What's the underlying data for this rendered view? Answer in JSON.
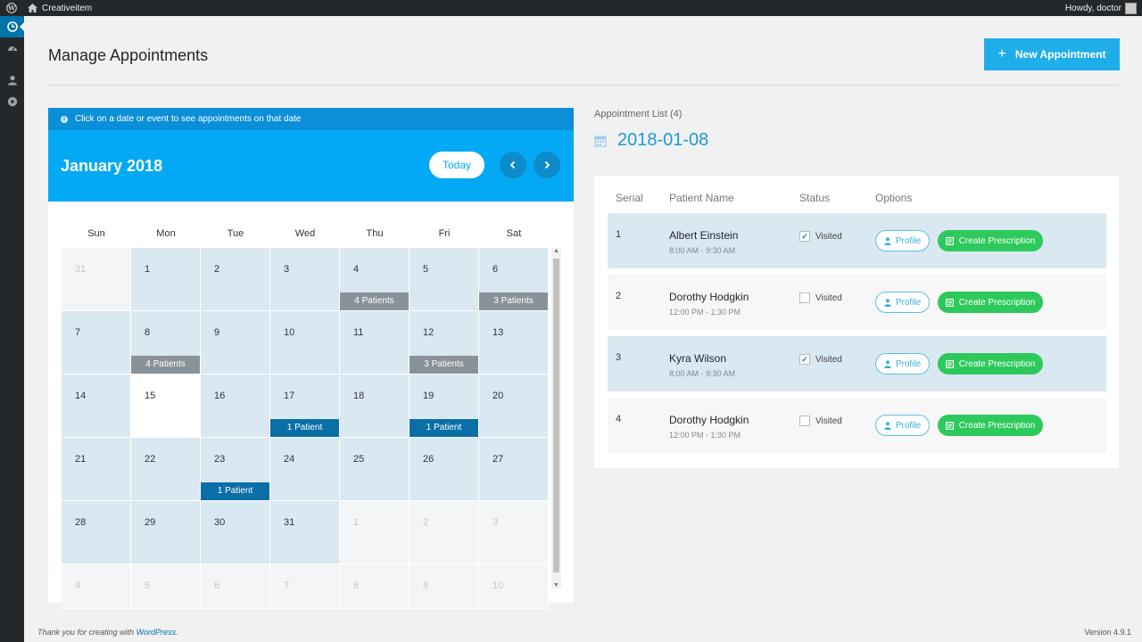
{
  "adminbar": {
    "site_name": "Creativeitem",
    "howdy": "Howdy, doctor"
  },
  "sidemenu": {
    "icons": [
      "clock-icon",
      "dashboard-icon",
      "user-icon",
      "play-icon"
    ]
  },
  "header": {
    "title": "Manage Appointments",
    "new_button": "New Appointment"
  },
  "calendar": {
    "info": "Click on a date or event to see appointments on that date",
    "month": "January 2018",
    "today_label": "Today",
    "days_of_week": [
      "Sun",
      "Mon",
      "Tue",
      "Wed",
      "Thu",
      "Fri",
      "Sat"
    ],
    "weeks": [
      [
        {
          "d": "31",
          "other": true
        },
        {
          "d": "1"
        },
        {
          "d": "2"
        },
        {
          "d": "3"
        },
        {
          "d": "4",
          "ev": "4 Patients",
          "c": "gray"
        },
        {
          "d": "5"
        },
        {
          "d": "6",
          "ev": "3 Patients",
          "c": "gray"
        }
      ],
      [
        {
          "d": "7"
        },
        {
          "d": "8",
          "ev": "4 Patients",
          "c": "gray"
        },
        {
          "d": "9"
        },
        {
          "d": "10"
        },
        {
          "d": "11"
        },
        {
          "d": "12",
          "ev": "3 Patients",
          "c": "gray"
        },
        {
          "d": "13"
        }
      ],
      [
        {
          "d": "14"
        },
        {
          "d": "15",
          "today": true
        },
        {
          "d": "16"
        },
        {
          "d": "17",
          "ev": "1 Patient",
          "c": "blue"
        },
        {
          "d": "18"
        },
        {
          "d": "19",
          "ev": "1 Patient",
          "c": "blue"
        },
        {
          "d": "20"
        }
      ],
      [
        {
          "d": "21"
        },
        {
          "d": "22"
        },
        {
          "d": "23",
          "ev": "1 Patient",
          "c": "blue"
        },
        {
          "d": "24"
        },
        {
          "d": "25"
        },
        {
          "d": "26"
        },
        {
          "d": "27"
        }
      ],
      [
        {
          "d": "28"
        },
        {
          "d": "29"
        },
        {
          "d": "30"
        },
        {
          "d": "31"
        },
        {
          "d": "1",
          "other": true
        },
        {
          "d": "2",
          "other": true
        },
        {
          "d": "3",
          "other": true
        }
      ],
      [
        {
          "d": "4",
          "other": true
        },
        {
          "d": "5",
          "other": true
        },
        {
          "d": "6",
          "other": true
        },
        {
          "d": "7",
          "other": true
        },
        {
          "d": "8",
          "other": true
        },
        {
          "d": "9",
          "other": true
        },
        {
          "d": "10",
          "other": true
        }
      ]
    ]
  },
  "appointments": {
    "label": "Appointment List (4)",
    "date": "2018-01-08",
    "columns": {
      "serial": "Serial",
      "name": "Patient Name",
      "status": "Status",
      "options": "Options"
    },
    "profile_label": "Profile",
    "prescription_label": "Create Prescription",
    "rows": [
      {
        "serial": "1",
        "name": "Albert Einstein",
        "time": "8:00 AM - 9:30 AM",
        "status": "Visited",
        "checked": true
      },
      {
        "serial": "2",
        "name": "Dorothy Hodgkin",
        "time": "12:00 PM - 1:30 PM",
        "status": "Visited",
        "checked": false
      },
      {
        "serial": "3",
        "name": "Kyra Wilson",
        "time": "8:00 AM - 9:30 AM",
        "status": "Visited",
        "checked": true
      },
      {
        "serial": "4",
        "name": "Dorothy Hodgkin",
        "time": "12:00 PM - 1:30 PM",
        "status": "Visited",
        "checked": false
      }
    ]
  },
  "footer": {
    "thanks": "Thank you for creating with ",
    "link": "WordPress",
    "suffix": ".",
    "version": "Version 4.9.1"
  },
  "colors": {
    "accent": "#03a9f4",
    "button": "#1faee9",
    "success": "#2ec95c",
    "event_gray": "#8a9299",
    "event_blue": "#0a6fa6"
  }
}
